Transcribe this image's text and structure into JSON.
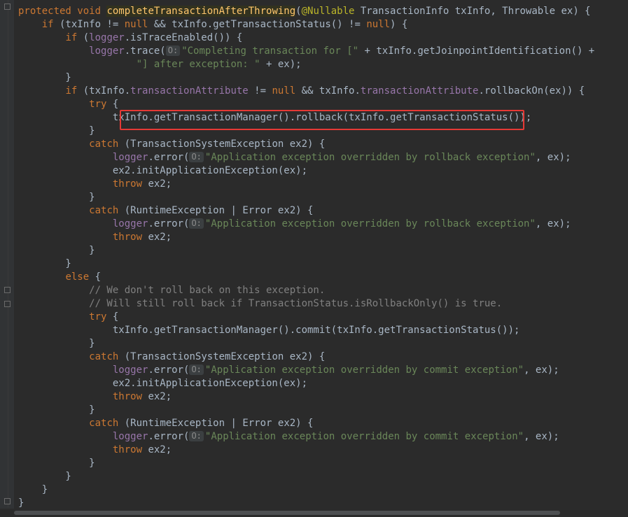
{
  "editor": {
    "lines": [
      {
        "segs": [
          {
            "t": "protected void ",
            "c": "kw"
          },
          {
            "t": "completeTransactionAfterThrowing",
            "c": "fn"
          },
          {
            "t": "("
          },
          {
            "t": "@Nullable",
            "c": "an"
          },
          {
            "t": " TransactionInfo txInfo, Throwable ex) {"
          }
        ]
      },
      {
        "segs": [
          {
            "t": "    "
          },
          {
            "t": "if",
            "c": "kw"
          },
          {
            "t": " (txInfo != "
          },
          {
            "t": "null",
            "c": "kw"
          },
          {
            "t": " && txInfo.getTransactionStatus() != "
          },
          {
            "t": "null",
            "c": "kw"
          },
          {
            "t": ") {"
          }
        ]
      },
      {
        "segs": [
          {
            "t": "        "
          },
          {
            "t": "if",
            "c": "kw"
          },
          {
            "t": " ("
          },
          {
            "t": "logger",
            "c": "fd"
          },
          {
            "t": ".isTraceEnabled()) {"
          }
        ]
      },
      {
        "segs": [
          {
            "t": "            "
          },
          {
            "t": "logger",
            "c": "fd"
          },
          {
            "t": ".trace("
          },
          {
            "t": "O:",
            "c": "hint"
          },
          {
            "t": "\"Completing transaction for [\"",
            "c": "st"
          },
          {
            "t": " + txInfo.getJoinpointIdentification() +"
          }
        ]
      },
      {
        "segs": [
          {
            "t": "                    "
          },
          {
            "t": "\"] after exception: \"",
            "c": "st"
          },
          {
            "t": " + ex);"
          }
        ]
      },
      {
        "segs": [
          {
            "t": "        }"
          }
        ]
      },
      {
        "segs": [
          {
            "t": "        "
          },
          {
            "t": "if",
            "c": "kw"
          },
          {
            "t": " (txInfo."
          },
          {
            "t": "transactionAttribute",
            "c": "fd"
          },
          {
            "t": " != "
          },
          {
            "t": "null",
            "c": "kw"
          },
          {
            "t": " && txInfo."
          },
          {
            "t": "transactionAttribute",
            "c": "fd"
          },
          {
            "t": ".rollbackOn(ex)) {"
          }
        ]
      },
      {
        "segs": [
          {
            "t": "            "
          },
          {
            "t": "try",
            "c": "kw"
          },
          {
            "t": " {"
          }
        ]
      },
      {
        "segs": [
          {
            "t": "                txInfo.getTransactionManager().rollback(txInfo.getTransactionStatus());"
          }
        ]
      },
      {
        "segs": [
          {
            "t": "            }"
          }
        ]
      },
      {
        "segs": [
          {
            "t": "            "
          },
          {
            "t": "catch",
            "c": "kw"
          },
          {
            "t": " (TransactionSystemException ex2) {"
          }
        ]
      },
      {
        "segs": [
          {
            "t": "                "
          },
          {
            "t": "logger",
            "c": "fd"
          },
          {
            "t": ".error("
          },
          {
            "t": "O:",
            "c": "hint"
          },
          {
            "t": "\"Application exception overridden by rollback exception\"",
            "c": "st"
          },
          {
            "t": ", ex);"
          }
        ]
      },
      {
        "segs": [
          {
            "t": "                ex2.initApplicationException(ex);"
          }
        ]
      },
      {
        "segs": [
          {
            "t": "                "
          },
          {
            "t": "throw",
            "c": "kw"
          },
          {
            "t": " ex2;"
          }
        ]
      },
      {
        "segs": [
          {
            "t": "            }"
          }
        ]
      },
      {
        "segs": [
          {
            "t": "            "
          },
          {
            "t": "catch",
            "c": "kw"
          },
          {
            "t": " (RuntimeException | Error ex2) {"
          }
        ]
      },
      {
        "segs": [
          {
            "t": "                "
          },
          {
            "t": "logger",
            "c": "fd"
          },
          {
            "t": ".error("
          },
          {
            "t": "O:",
            "c": "hint"
          },
          {
            "t": "\"Application exception overridden by rollback exception\"",
            "c": "st"
          },
          {
            "t": ", ex);"
          }
        ]
      },
      {
        "segs": [
          {
            "t": "                "
          },
          {
            "t": "throw",
            "c": "kw"
          },
          {
            "t": " ex2;"
          }
        ]
      },
      {
        "segs": [
          {
            "t": "            }"
          }
        ]
      },
      {
        "segs": [
          {
            "t": "        }"
          }
        ]
      },
      {
        "segs": [
          {
            "t": "        "
          },
          {
            "t": "else",
            "c": "kw"
          },
          {
            "t": " {"
          }
        ]
      },
      {
        "segs": [
          {
            "t": "            // We don't roll back on this exception.",
            "c": "cm"
          }
        ]
      },
      {
        "segs": [
          {
            "t": "            // Will still roll back if TransactionStatus.isRollbackOnly() is true.",
            "c": "cm"
          }
        ]
      },
      {
        "segs": [
          {
            "t": "            "
          },
          {
            "t": "try",
            "c": "kw"
          },
          {
            "t": " {"
          }
        ]
      },
      {
        "segs": [
          {
            "t": "                txInfo.getTransactionManager().commit(txInfo.getTransactionStatus());"
          }
        ]
      },
      {
        "segs": [
          {
            "t": "            }"
          }
        ]
      },
      {
        "segs": [
          {
            "t": "            "
          },
          {
            "t": "catch",
            "c": "kw"
          },
          {
            "t": " (TransactionSystemException ex2) {"
          }
        ]
      },
      {
        "segs": [
          {
            "t": "                "
          },
          {
            "t": "logger",
            "c": "fd"
          },
          {
            "t": ".error("
          },
          {
            "t": "O:",
            "c": "hint"
          },
          {
            "t": "\"Application exception overridden by commit exception\"",
            "c": "st"
          },
          {
            "t": ", ex);"
          }
        ]
      },
      {
        "segs": [
          {
            "t": "                ex2.initApplicationException(ex);"
          }
        ]
      },
      {
        "segs": [
          {
            "t": "                "
          },
          {
            "t": "throw",
            "c": "kw"
          },
          {
            "t": " ex2;"
          }
        ]
      },
      {
        "segs": [
          {
            "t": "            }"
          }
        ]
      },
      {
        "segs": [
          {
            "t": "            "
          },
          {
            "t": "catch",
            "c": "kw"
          },
          {
            "t": " (RuntimeException | Error ex2) {"
          }
        ]
      },
      {
        "segs": [
          {
            "t": "                "
          },
          {
            "t": "logger",
            "c": "fd"
          },
          {
            "t": ".error("
          },
          {
            "t": "O:",
            "c": "hint"
          },
          {
            "t": "\"Application exception overridden by commit exception\"",
            "c": "st"
          },
          {
            "t": ", ex);"
          }
        ]
      },
      {
        "segs": [
          {
            "t": "                "
          },
          {
            "t": "throw",
            "c": "kw"
          },
          {
            "t": " ex2;"
          }
        ]
      },
      {
        "segs": [
          {
            "t": "            }"
          }
        ]
      },
      {
        "segs": [
          {
            "t": "        }"
          }
        ]
      },
      {
        "segs": [
          {
            "t": "    }"
          }
        ]
      },
      {
        "segs": [
          {
            "t": "}"
          }
        ]
      }
    ]
  },
  "colors": {
    "background": "#2b2b2b",
    "keyword": "#cc7832",
    "method_declaration": "#ffc66d",
    "annotation": "#bbb529",
    "field": "#9876aa",
    "string": "#6a8759",
    "comment": "#808080",
    "highlight_box": "#e53935"
  }
}
